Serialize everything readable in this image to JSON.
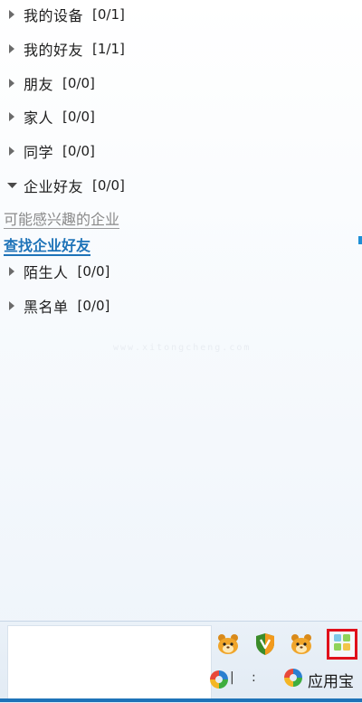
{
  "groups": [
    {
      "name": "我的设备",
      "count": "[0/1]",
      "expanded": false
    },
    {
      "name": "我的好友",
      "count": "[1/1]",
      "expanded": false
    },
    {
      "name": "朋友",
      "count": "[0/0]",
      "expanded": false
    },
    {
      "name": "家人",
      "count": "[0/0]",
      "expanded": false
    },
    {
      "name": "同学",
      "count": "[0/0]",
      "expanded": false
    },
    {
      "name": "企业好友",
      "count": "[0/0]",
      "expanded": true
    },
    {
      "name": "陌生人",
      "count": "[0/0]",
      "expanded": false
    },
    {
      "name": "黑名单",
      "count": "[0/0]",
      "expanded": false
    }
  ],
  "enterprise": {
    "interested_label": "可能感兴趣的企业",
    "find_label": "查找企业好友"
  },
  "watermark": "www.xitongcheng.com",
  "toolbar": {
    "icons": [
      "pet-icon",
      "shield-icon",
      "pet-icon",
      "apps-grid-icon"
    ],
    "mini_sep": ":",
    "yyb_label": "应用宝"
  },
  "colors": {
    "link_blue": "#1e73b8",
    "muted_gray": "#8a8a8a",
    "highlight_red": "#e0101b"
  }
}
